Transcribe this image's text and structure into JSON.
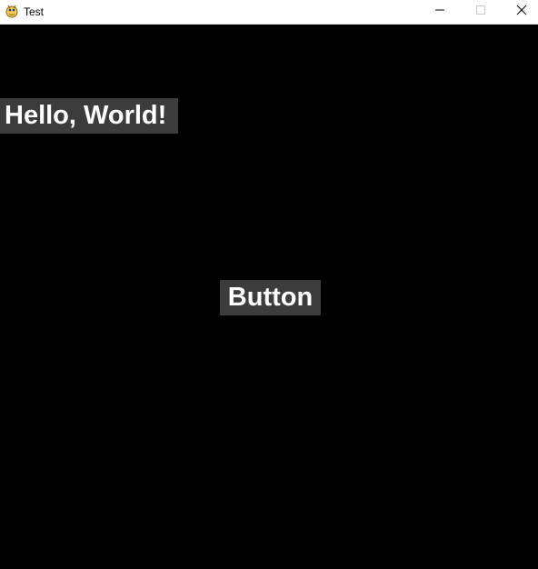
{
  "window": {
    "title": "Test",
    "app_icon": "python-snake-icon",
    "controls": {
      "minimize_icon": "minimize-icon",
      "maximize_icon": "maximize-icon",
      "close_icon": "close-icon"
    }
  },
  "content": {
    "background_color": "#000000",
    "label_text": "Hello, World!",
    "button_label": "Button",
    "widget_background": "#3c3c3c",
    "widget_text_color": "#ffffff"
  }
}
